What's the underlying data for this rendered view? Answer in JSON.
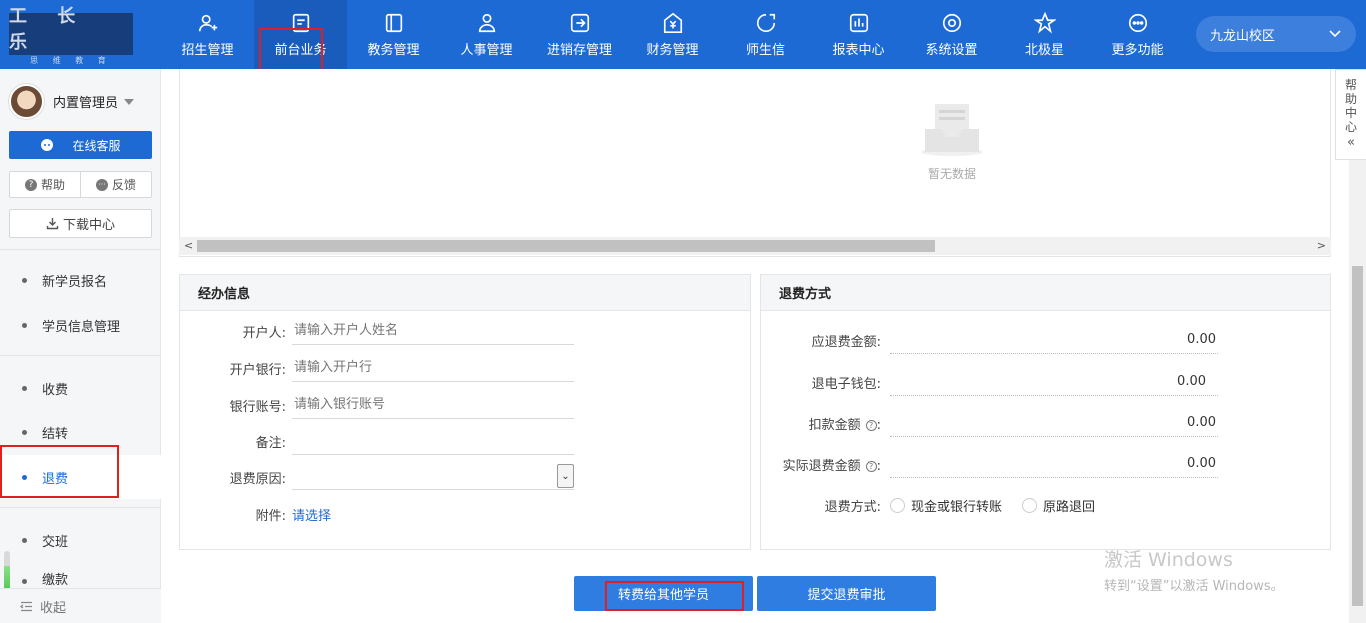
{
  "logo": {
    "line1": "工 长 乐",
    "line2": "思 维 教 育"
  },
  "nav": [
    {
      "label": "招生管理",
      "icon": "user-plus-icon"
    },
    {
      "label": "前台业务",
      "icon": "front-desk-icon"
    },
    {
      "label": "教务管理",
      "icon": "book-icon"
    },
    {
      "label": "人事管理",
      "icon": "person-icon"
    },
    {
      "label": "进销存管理",
      "icon": "inventory-icon"
    },
    {
      "label": "财务管理",
      "icon": "finance-icon"
    },
    {
      "label": "师生信",
      "icon": "chat-icon"
    },
    {
      "label": "报表中心",
      "icon": "report-icon"
    },
    {
      "label": "系统设置",
      "icon": "settings-icon"
    },
    {
      "label": "北极星",
      "icon": "star-icon"
    },
    {
      "label": "更多功能",
      "icon": "more-icon"
    }
  ],
  "campus": {
    "name": "九龙山校区"
  },
  "sidebar": {
    "user_name": "内置管理员",
    "online_service": "在线客服",
    "help": "帮助",
    "feedback": "反馈",
    "download_center": "下载中心",
    "menu": [
      {
        "label": "新学员报名"
      },
      {
        "label": "学员信息管理"
      },
      {
        "label": "收费"
      },
      {
        "label": "结转"
      },
      {
        "label": "退费"
      },
      {
        "label": "交班"
      },
      {
        "label": "缴款"
      }
    ],
    "collapse": "收起",
    "progress_fraction": 0.75
  },
  "table": {
    "empty_text": "暂无数据"
  },
  "handler_panel": {
    "title": "经办信息",
    "fields": {
      "account_holder": {
        "label": "开户人:",
        "placeholder": "请输入开户人姓名"
      },
      "bank": {
        "label": "开户银行:",
        "placeholder": "请输入开户行"
      },
      "account_no": {
        "label": "银行账号:",
        "placeholder": "请输入银行账号"
      },
      "remark": {
        "label": "备注:",
        "value": ""
      },
      "reason": {
        "label": "退费原因:",
        "value": ""
      },
      "attachment": {
        "label": "附件:",
        "link": "请选择"
      }
    }
  },
  "refund_panel": {
    "title": "退费方式",
    "rows": {
      "due": {
        "label": "应退费金额:",
        "value": "0.00"
      },
      "wallet": {
        "label": "退电子钱包:",
        "value": "0.00"
      },
      "deduct": {
        "label": "扣款金额",
        "value": "0.00"
      },
      "actual": {
        "label": "实际退费金额",
        "value": "0.00"
      }
    },
    "method_label": "退费方式:",
    "methods": [
      "现金或银行转账",
      "原路退回"
    ]
  },
  "actions": {
    "transfer": "转费给其他学员",
    "submit": "提交退费审批"
  },
  "help_center": [
    "帮",
    "助",
    "中",
    "心"
  ],
  "watermark": {
    "line1": "激活 Windows",
    "line2": "转到“设置”以激活 Windows。"
  }
}
